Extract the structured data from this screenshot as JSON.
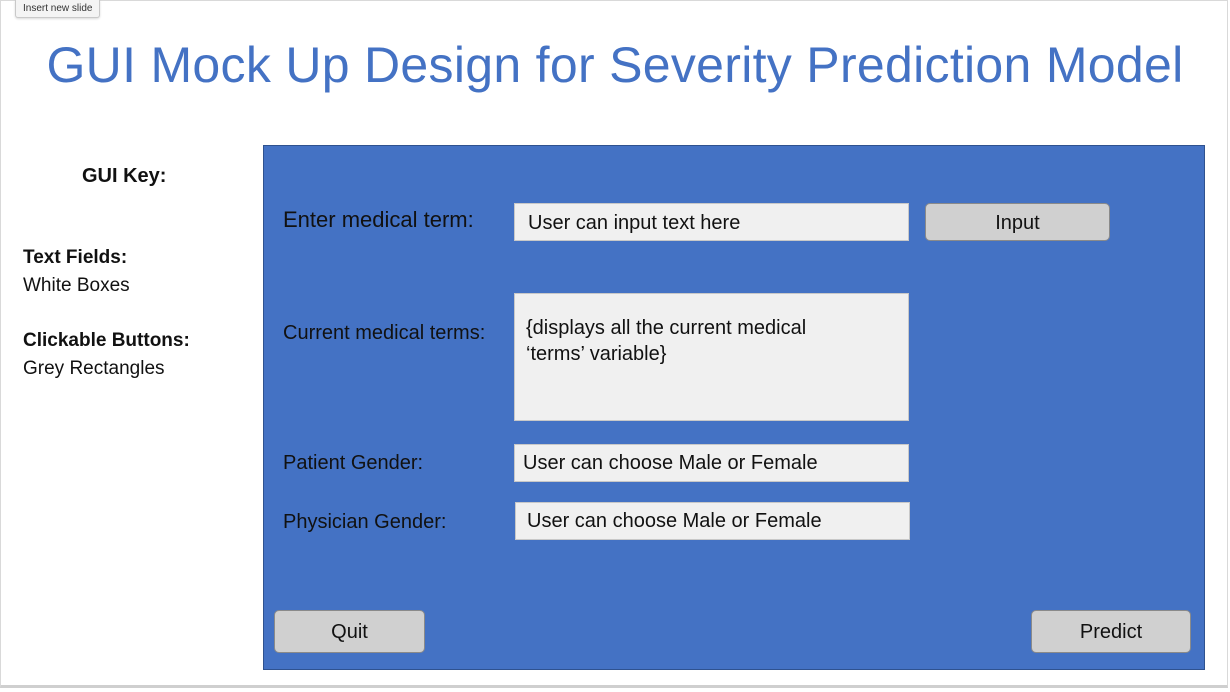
{
  "toolbar": {
    "insert_new_slide": "Insert new slide"
  },
  "slide": {
    "title": "GUI Mock Up Design for Severity Prediction Model"
  },
  "key": {
    "heading": "GUI Key:",
    "text_fields_label": "Text Fields:",
    "text_fields_value": "White Boxes",
    "buttons_label": "Clickable Buttons:",
    "buttons_value": "Grey Rectangles"
  },
  "form": {
    "medical_term_label": "Enter medical term:",
    "medical_term_value": "User can input text here",
    "input_button": "Input",
    "current_terms_label": "Current medical terms:",
    "current_terms_value": "{displays all the current medical\n‘terms’ variable}",
    "patient_gender_label": "Patient Gender:",
    "patient_gender_value": "User can choose Male or Female",
    "physician_gender_label": "Physician Gender:",
    "physician_gender_value": "User can choose Male or Female",
    "quit_button": "Quit",
    "predict_button": "Predict"
  },
  "colors": {
    "title": "#4472c4",
    "panel": "#4472c4",
    "textbox": "#f0f0f0",
    "button": "#d0d0d0"
  }
}
